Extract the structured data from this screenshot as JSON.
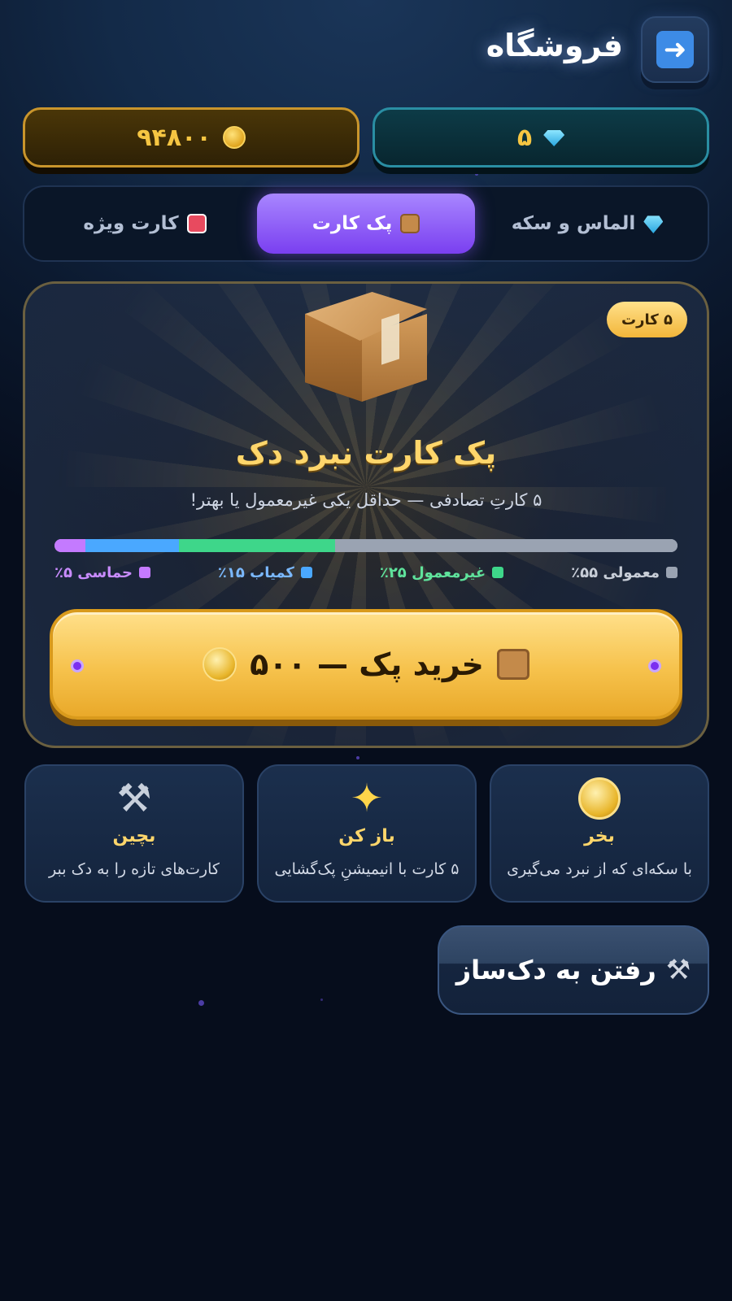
{
  "header": {
    "title": "فروشگاه",
    "back_icon": "arrow-right-icon"
  },
  "currency": {
    "gems": "۵",
    "coins": "۹۴۸۰۰"
  },
  "tabs": [
    {
      "label": "الماس و سکه",
      "icon": "gem-icon",
      "active": false
    },
    {
      "label": "پک کارت",
      "icon": "box-icon",
      "active": true
    },
    {
      "label": "کارت ویژه",
      "icon": "card-icon",
      "active": false
    }
  ],
  "pack": {
    "badge": "۵ کارت",
    "title": "پک کارت نبرد دک",
    "subtitle": "۵ کارتِ تصادفی — حداقل یکی غیرمعمول یا بهتر!",
    "rarities": [
      {
        "label": "معمولی ۵۵٪",
        "percent": 55,
        "color": "#9aa3b2",
        "text_color": "#c8ced8"
      },
      {
        "label": "غیرمعمول ۲۵٪",
        "percent": 25,
        "color": "#3ed68a",
        "text_color": "#5fe39c"
      },
      {
        "label": "کمیاب ۱۵٪",
        "percent": 15,
        "color": "#4aa8ff",
        "text_color": "#7ab8ff"
      },
      {
        "label": "حماسی ۵٪",
        "percent": 5,
        "color": "#c47aff",
        "text_color": "#c98cff"
      }
    ],
    "buy_label": "خرید پک — ۵۰۰"
  },
  "info_cards": [
    {
      "title": "بخر",
      "desc": "با سکه‌ای که از نبرد می‌گیری",
      "icon": "coin-icon"
    },
    {
      "title": "باز کن",
      "desc": "۵ کارت با انیمیشنِ پک‌گشایی",
      "icon": "sparkles-icon"
    },
    {
      "title": "بچین",
      "desc": "کارت‌های تازه را به دک ببر",
      "icon": "tools-icon"
    }
  ],
  "deck_button": {
    "label": "رفتن به دک‌ساز",
    "icon": "tools-icon"
  }
}
